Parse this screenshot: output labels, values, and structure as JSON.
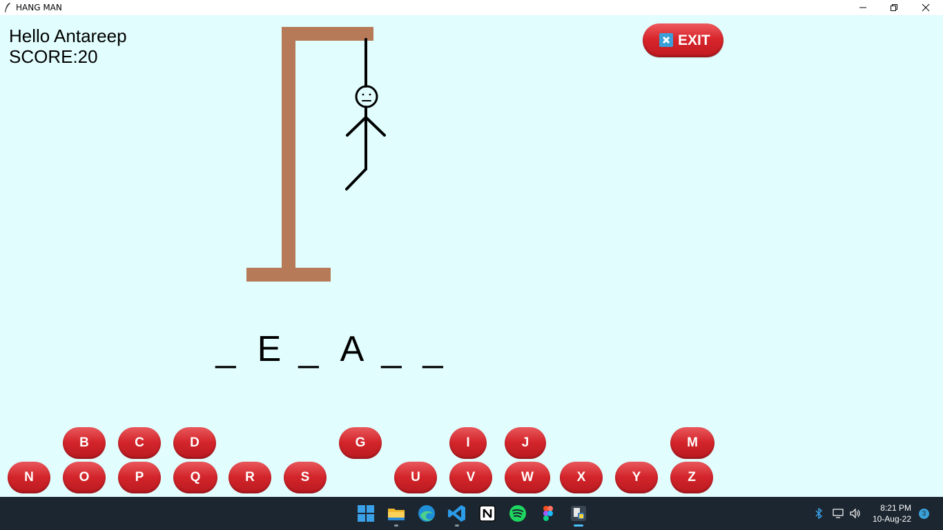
{
  "window": {
    "title": "HANG MAN"
  },
  "player": {
    "greeting": "Hello Antareep",
    "score_text": "SCORE:20"
  },
  "exit_button": {
    "label": "EXIT"
  },
  "word": {
    "slots": [
      "_",
      "E",
      "_",
      "A",
      "_",
      "_"
    ]
  },
  "keyboard": {
    "row1": [
      "B",
      "C",
      "D",
      "G",
      "I",
      "J",
      "M"
    ],
    "row2": [
      "N",
      "O",
      "P",
      "Q",
      "R",
      "S",
      "U",
      "V",
      "W",
      "X",
      "Y",
      "Z"
    ]
  },
  "colors": {
    "background": "#e1fdfd",
    "gallows": "#b77a58",
    "button": "#d3252b",
    "taskbar": "#1c2630"
  },
  "taskbar": {
    "apps": [
      "windows-start-icon",
      "file-explorer-icon",
      "edge-icon",
      "vscode-icon",
      "notion-icon",
      "spotify-icon",
      "figma-icon",
      "python-icon"
    ],
    "time": "8:21 PM",
    "date": "10-Aug-22",
    "notification_count": "3"
  }
}
